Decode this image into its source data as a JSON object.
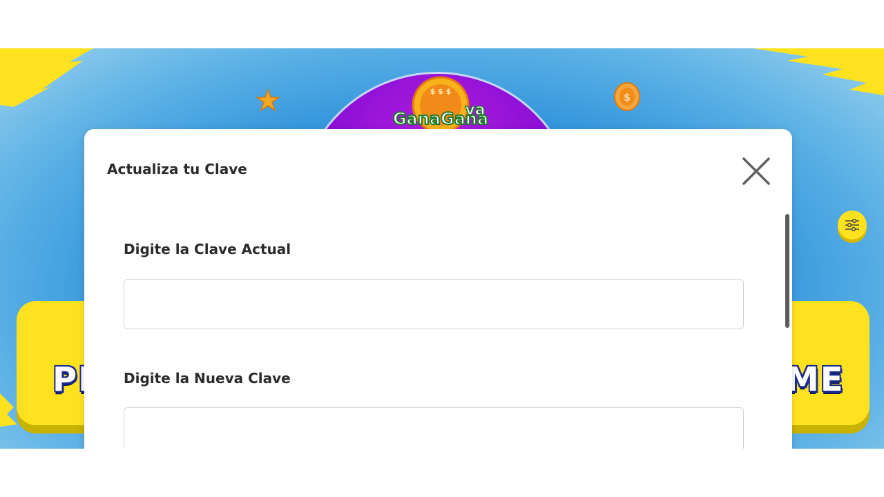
{
  "background": {
    "brand_colors": {
      "sky_blue": "#1782d6",
      "yellow": "#ffe21f",
      "purple": "#8e10d6"
    },
    "logo_text_top": "$ $ $",
    "logo_text_main": "GanaGana",
    "logo_text_extra": "va",
    "panel_left_text": "PL",
    "panel_right_text": "ME",
    "icons": [
      "star-icon",
      "coin-icon",
      "filter-sliders-icon"
    ]
  },
  "modal": {
    "title": "Actualiza tu Clave",
    "close_icon": "close-icon",
    "fields": [
      {
        "label": "Digite la Clave Actual",
        "value": "",
        "placeholder": ""
      },
      {
        "label": "Digite la Nueva Clave",
        "value": "",
        "placeholder": ""
      }
    ]
  }
}
